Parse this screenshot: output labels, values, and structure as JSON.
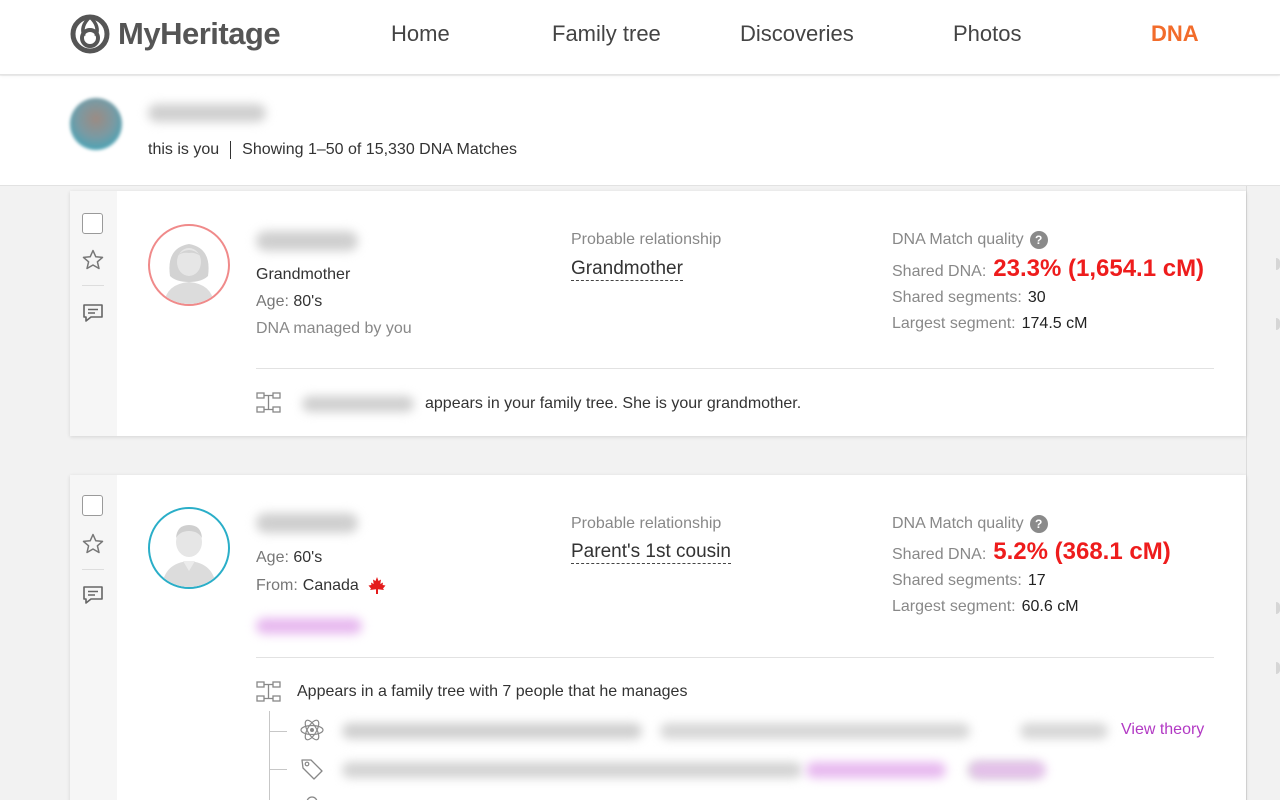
{
  "brand": {
    "name": "MyHeritage",
    "accent": "#f26c2b"
  },
  "nav": {
    "home": "Home",
    "family_tree": "Family tree",
    "discoveries": "Discoveries",
    "photos": "Photos",
    "dna": "DNA"
  },
  "profile": {
    "you_label": "this is you",
    "showing": "Showing 1–50 of 15,330 DNA Matches"
  },
  "labels": {
    "probable_relationship": "Probable relationship",
    "quality": "DNA Match quality",
    "help": "?",
    "shared_dna": "Shared DNA:",
    "shared_segments": "Shared segments:",
    "largest_segment": "Largest segment:",
    "age": "Age:",
    "from": "From:"
  },
  "matches": [
    {
      "relation_to_user": "Grandmother",
      "age": "80's",
      "managed": "DNA managed by you",
      "probable_relationship": "Grandmother",
      "shared_dna": "23.3% (1,654.1 cM)",
      "shared_segments": "30",
      "largest_segment": "174.5 cM",
      "tree_text": "appears in your family tree. She is your grandmother.",
      "avatar_ring_color": "#f08a8a"
    },
    {
      "age": "60's",
      "from": "Canada",
      "flag_icon": "canada-flag-icon",
      "probable_relationship": "Parent's 1st cousin",
      "shared_dna": "5.2% (368.1 cM)",
      "shared_segments": "17",
      "largest_segment": "60.6 cM",
      "tree_text": "Appears in a family tree with 7 people that he manages",
      "view_theory": "View theory",
      "avatar_ring_color": "#2aaec8"
    }
  ],
  "colors": {
    "shared_dna": "#ee1c1c",
    "link_purple": "#b239c4"
  }
}
